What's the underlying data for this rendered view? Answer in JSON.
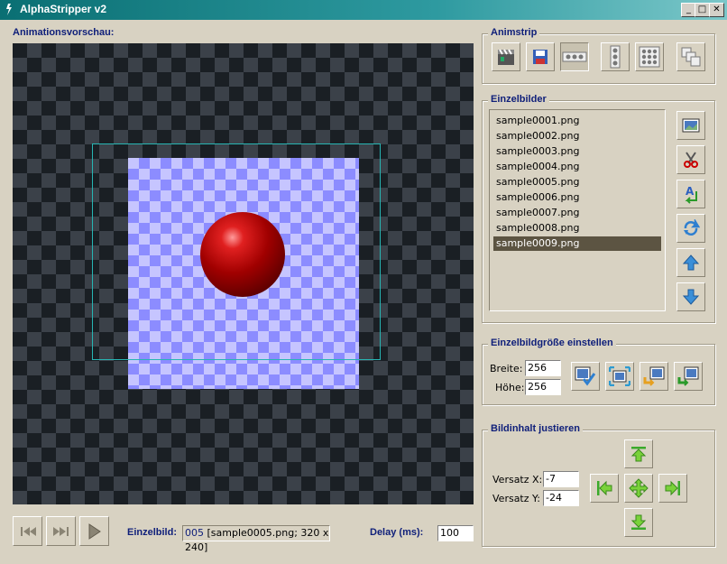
{
  "window": {
    "title": "AlphaStripper v2",
    "min": "_",
    "max": "□",
    "close": "✕"
  },
  "preview": {
    "label": "Animationsvorschau:"
  },
  "animstrip": {
    "label": "Animstrip"
  },
  "frames": {
    "label": "Einzelbilder",
    "items": [
      "sample0001.png",
      "sample0002.png",
      "sample0003.png",
      "sample0004.png",
      "sample0005.png",
      "sample0006.png",
      "sample0007.png",
      "sample0008.png",
      "sample0009.png"
    ],
    "selected_index": 8
  },
  "size": {
    "label": "Einzelbildgröße einstellen",
    "width_label": "Breite:",
    "width": "256",
    "height_label": "Höhe:",
    "height": "256"
  },
  "adjust": {
    "label": "Bildinhalt justieren",
    "offset_x_label": "Versatz X:",
    "offset_x": "-7",
    "offset_y_label": "Versatz Y:",
    "offset_y": "-24"
  },
  "playback": {
    "frame_label": "Einzelbild:",
    "frame_number": "005",
    "frame_info": " [sample0005.png; 320 x 240]",
    "delay_label": "Delay (ms):",
    "delay": "100"
  },
  "colors": {
    "accent_label": "#10207a",
    "selection": "#5c5442",
    "title_bar": "#0a6f73"
  }
}
